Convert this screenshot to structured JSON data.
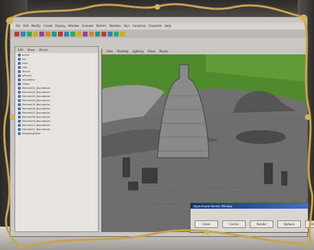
{
  "menubar": {
    "items": [
      "File",
      "Edit",
      "Modify",
      "Create",
      "Display",
      "Window",
      "Animate",
      "Deform",
      "Skeleton",
      "Skin",
      "Constrain",
      "Character",
      "Help"
    ]
  },
  "toolbar": {
    "icons": [
      "move-icon",
      "rotate-icon",
      "scale-icon",
      "select-icon",
      "lasso-icon",
      "snap-grid-icon",
      "snap-curve-icon",
      "snap-point-icon",
      "render-icon",
      "ipr-render-icon",
      "render-settings-icon",
      "hypershade-icon",
      "outliner-icon",
      "graph-editor-icon",
      "channel-box-icon",
      "layer-editor-icon",
      "tool-settings-icon",
      "attribute-editor-icon"
    ],
    "colors": [
      "#c0392b",
      "#2e86c1",
      "#27ae60",
      "#d4ac0d",
      "#8e44ad",
      "#e67e22",
      "#16a085",
      "#c0392b",
      "#2e86c1",
      "#27ae60",
      "#d4ac0d",
      "#8e44ad",
      "#e67e22",
      "#16a085",
      "#c0392b",
      "#2e86c1",
      "#27ae60",
      "#d4ac0d"
    ]
  },
  "outliner": {
    "menu": [
      "Edit",
      "Show",
      "Panels"
    ],
    "rows": [
      "persp",
      "top",
      "front",
      "side",
      "Terrain",
      "pPlane1",
      "mountains",
      "Group",
      "Element01_Boundaries",
      "Element02_Boundaries",
      "Element03_Boundaries",
      "Element04_Boundaries",
      "Element05_Boundaries",
      "Element06_Boundaries",
      "Element07_Boundaries",
      "Element08_Boundaries",
      "Element09_Boundaries",
      "Element10_Boundaries",
      "Element11_Boundaries",
      "defaultLightSet"
    ]
  },
  "viewport": {
    "menu": [
      "View",
      "Shading",
      "Lighting",
      "Show",
      "Panels"
    ]
  },
  "dialog": {
    "title": "Hypershade Render Window",
    "buttons": [
      "Close",
      "Cancel",
      "Render",
      "Options",
      "Advanced"
    ]
  },
  "colors": {
    "frame_gold": "#c9a24a",
    "titlebar_blue": "#0a2f7a",
    "foliage_green": "#4f8a2c",
    "ground_gray": "#6e6e6e"
  }
}
